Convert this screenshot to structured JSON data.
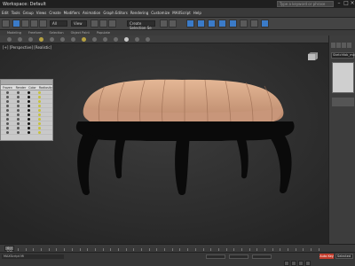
{
  "titlebar": {
    "workspace": "Workspace: Default",
    "search_placeholder": "Type a keyword or phrase"
  },
  "menu": [
    "Edit",
    "Tools",
    "Group",
    "Views",
    "Create",
    "Modifiers",
    "Animation",
    "Graph Editors",
    "Rendering",
    "Customize",
    "MAXScript",
    "Help"
  ],
  "toolbar": {
    "selection_filter": "All",
    "ref_coord": "View",
    "named_selection": "Create Selection Se"
  },
  "ribbon_tabs": [
    "Modeling",
    "Freeform",
    "Selection",
    "Object Paint",
    "Populate"
  ],
  "viewport": {
    "label": "[+] [Perspective] [Realistic]"
  },
  "scene_explorer": {
    "columns": [
      "Frozen",
      "Render",
      "Color",
      "Radiosity"
    ],
    "rows": 10
  },
  "command_panel": {
    "object_name": "Sketchfab_mo"
  },
  "timeline": {
    "slider": "0 / 100"
  },
  "status": {
    "maxscript": "MAXScript Mi",
    "x": "",
    "y": "",
    "z": "",
    "autokey": "Auto Key",
    "selected": "Selected",
    "set_key": "Set Key"
  }
}
